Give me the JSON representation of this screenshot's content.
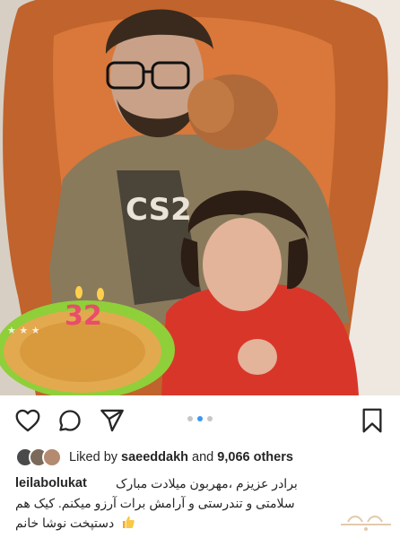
{
  "post": {
    "image_alt": "",
    "carousel": {
      "total": 3,
      "active": 2
    }
  },
  "likes": {
    "prefix": "Liked by",
    "user": "saeeddakh",
    "conjunction": "and",
    "others": "9,066 others"
  },
  "caption": {
    "username": "leilabolukat",
    "line1": "برادر عزیزم ،مهربون میلادت مبارک",
    "line2": "سلامتی و تندرستی و آرامش برات آرزو میکنم. کیک هم",
    "line3": "دستپخت نوشا خانم"
  },
  "icons": {
    "like": "heart-icon",
    "comment": "comment-icon",
    "share": "send-icon",
    "save": "bookmark-icon"
  },
  "colors": {
    "carousel_active": "#3897f0",
    "carousel_inactive": "#c7c7c7",
    "text": "#262626"
  }
}
